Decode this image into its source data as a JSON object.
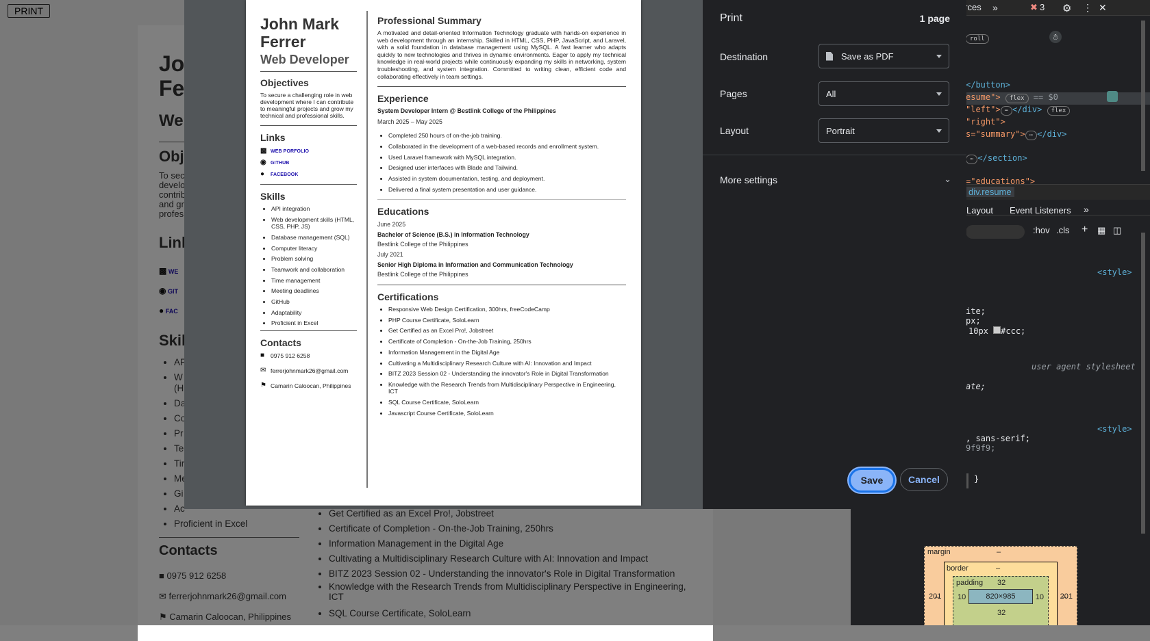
{
  "background": {
    "print_button": "PRINT",
    "name_first": "Jo",
    "name_last": "Fe",
    "role": "We",
    "objectives": "Obje",
    "obj_text": [
      "To sec",
      "develo",
      "contrib",
      "and gr",
      "profes"
    ],
    "links": "Link",
    "link_items": [
      "WE",
      "GIT",
      "FAC"
    ],
    "skills": "Skill",
    "skill_items": [
      "AP",
      "W",
      "(H",
      "Da",
      "Co",
      "Pr",
      "Te",
      "Tir",
      "Me",
      "Gi",
      "Ac",
      "Proficient in Excel"
    ],
    "contacts": "Contacts",
    "contact_items": [
      "0975 912 6258",
      "ferrerjohnmark26@gmail.com",
      "Camarin Caloocan, Philippines"
    ],
    "cert_items": [
      "Get Certified as an Excel Pro!, Jobstreet",
      "Certificate of Completion - On-the-Job Training, 250hrs",
      "Information Management in the Digital Age",
      "Cultivating a Multidisciplinary Research Culture with AI: Innovation and Impact",
      "BITZ 2023 Session 02 - Understanding the innovator's Role in Digital Transformation",
      "Knowledge with the Research Trends from Multidisciplinary Perspective in Engineering, ICT",
      "SQL Course Certificate, SoloLearn"
    ]
  },
  "resume": {
    "name": "John Mark Ferrer",
    "title": "Web Developer",
    "objectives_heading": "Objectives",
    "objectives_text": "To secure a challenging role in web development where I can contribute to meaningful projects and grow my technical and professional skills.",
    "links_heading": "Links",
    "links": [
      {
        "label": "WEB PORFOLIO",
        "icon": "folder-icon"
      },
      {
        "label": "GITHUB",
        "icon": "github-icon"
      },
      {
        "label": "FACEBOOK",
        "icon": "facebook-icon"
      }
    ],
    "skills_heading": "Skills",
    "skills": [
      "API integration",
      "Web development skills (HTML, CSS, PHP, JS)",
      "Database management (SQL)",
      "Computer literacy",
      "Problem solving",
      "Teamwork and collaboration",
      "Time management",
      "Meeting deadlines",
      "GitHub",
      "Adaptability",
      "Proficient in Excel"
    ],
    "contacts_heading": "Contacts",
    "contacts": [
      {
        "text": "0975 912 6258",
        "icon": "phone-icon"
      },
      {
        "text": "ferrerjohnmark26@gmail.com",
        "icon": "mail-icon"
      },
      {
        "text": "Camarin Caloocan, Philippines",
        "icon": "signpost-icon"
      }
    ],
    "summary_heading": "Professional Summary",
    "summary_text": "A motivated and detail-oriented Information Technology graduate with hands-on experience in web development through an internship. Skilled in HTML, CSS, PHP, JavaScript, and Laravel, with a solid foundation in database management using MySQL. A fast learner who adapts quickly to new technologies and thrives in dynamic environments. Eager to apply my technical knowledge in real-world projects while continuously expanding my skills in networking, system troubleshooting, and system integration. Committed to writing clean, efficient code and collaborating effectively in team settings.",
    "experience_heading": "Experience",
    "job_title": "System Developer Intern @ Bestlink College of the Philippines",
    "job_dates": "March 2025 – May 2025",
    "job_items": [
      "Completed 250 hours of on-the-job training.",
      "Collaborated in the development of a web-based records and enrollment system.",
      "Used Laravel framework with MySQL integration.",
      "Designed user interfaces with Blade and Tailwind.",
      "Assisted in system documentation, testing, and deployment.",
      "Delivered a final system presentation and user guidance."
    ],
    "educations_heading": "Educations",
    "edu": [
      {
        "date": "June 2025",
        "degree": "Bachelor of Science (B.S.) in Information Technology",
        "school": "Bestlink College of the Philippines"
      },
      {
        "date": "July 2021",
        "degree": "Senior High Diploma in Information and Communication Technology",
        "school": "Bestlink College of the Philippines"
      }
    ],
    "certifications_heading": "Certifications",
    "certifications": [
      "Responsive Web Design Certification, 300hrs, freeCodeCamp",
      "PHP Course Certificate, SoloLearn",
      "Get Certified as an Excel Pro!, Jobstreet",
      "Certificate of Completion - On-the-Job Training, 250hrs",
      "Information Management in the Digital Age",
      "Cultivating a Multidisciplinary Research Culture with AI: Innovation and Impact",
      "BITZ 2023 Session 02 - Understanding the innovator's Role in Digital Transformation",
      "Knowledge with the Research Trends from Multidisciplinary Perspective in Engineering, ICT",
      "SQL Course Certificate, SoloLearn",
      "Javascript Course Certificate, SoloLearn"
    ]
  },
  "print": {
    "title": "Print",
    "page_count": "1 page",
    "destination_label": "Destination",
    "destination_value": "Save as PDF",
    "pages_label": "Pages",
    "pages_value": "All",
    "layout_label": "Layout",
    "layout_value": "Portrait",
    "more_settings": "More settings",
    "save": "Save",
    "cancel": "Cancel"
  },
  "devtools": {
    "sources_tab": "Sources",
    "error_count": "3",
    "code_lines": [
      "roll",
      "</button>",
      "esume\">",
      "== $0",
      "\"left\">",
      "</div>",
      "\"right\">",
      "s=\"summary\">",
      "</div>",
      "</section>",
      "=\"educations\">"
    ],
    "flex_badge": "flex",
    "breadcrumb": "div.resume",
    "tab_layout": "Layout",
    "tab_event_listeners": "Event Listeners",
    "filter_hov": ":hov",
    "filter_cls": ".cls",
    "style_tag": "<style>",
    "css_lines": [
      "ite;",
      "px;",
      "10px",
      "#ccc;"
    ],
    "user_agent": "user agent stylesheet",
    "css_ate": "ate;",
    "css_font": ", sans-serif;",
    "css_bg": "9f9f9;",
    "brace": "}",
    "box_margin": "margin",
    "box_border": "border",
    "box_padding": "padding",
    "box_dash": "–",
    "margin_side": "201",
    "padding_top": "32",
    "padding_side": "10",
    "padding_bottom": "32",
    "content_size": "820×985"
  }
}
